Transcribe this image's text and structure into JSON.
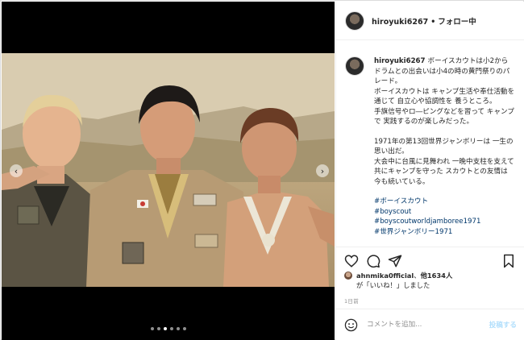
{
  "header": {
    "username": "hiroyuki6267",
    "separator": "•",
    "follow_label": "フォロー中"
  },
  "caption": {
    "username": "hiroyuki6267",
    "paragraphs": [
      "ボーイスカウトは小2から ドラムとの出会いは小4の時の黄門祭りのパレード。",
      "ボーイスカウトは キャンプ生活や奉仕活動を通じて 自立心や協調性を 養うところ。",
      "手旗信号やロ―ピングなどを習って キャンプで 実践するのが楽しみだった。",
      "",
      "1971年の第13回世界ジャンボリーは 一生の思い出だ。",
      "大会中に台風に見舞われ 一晩中支柱を支えて共にキャンプを守った スカウトとの友情は 今も続いている。",
      ""
    ],
    "hashtags": [
      "#ボーイスカウト",
      "#boyscout",
      "#boyscoutworldjamboree1971",
      "#世界ジャンボリー1971"
    ]
  },
  "likes": {
    "liker": "ahnmika0fficial",
    "others": "他1634人",
    "suffix": "が「いいね！」しました",
    "sep": "、"
  },
  "timestamp": "1日前",
  "comment": {
    "placeholder": "コメントを追加...",
    "post_label": "投稿する"
  },
  "carousel": {
    "total": 6,
    "active_index": 2
  },
  "icons": {
    "like": "heart-icon",
    "comment": "comment-icon",
    "share": "share-icon",
    "save": "bookmark-icon",
    "emoji": "emoji-icon",
    "prev": "chevron-left-icon",
    "next": "chevron-right-icon"
  }
}
